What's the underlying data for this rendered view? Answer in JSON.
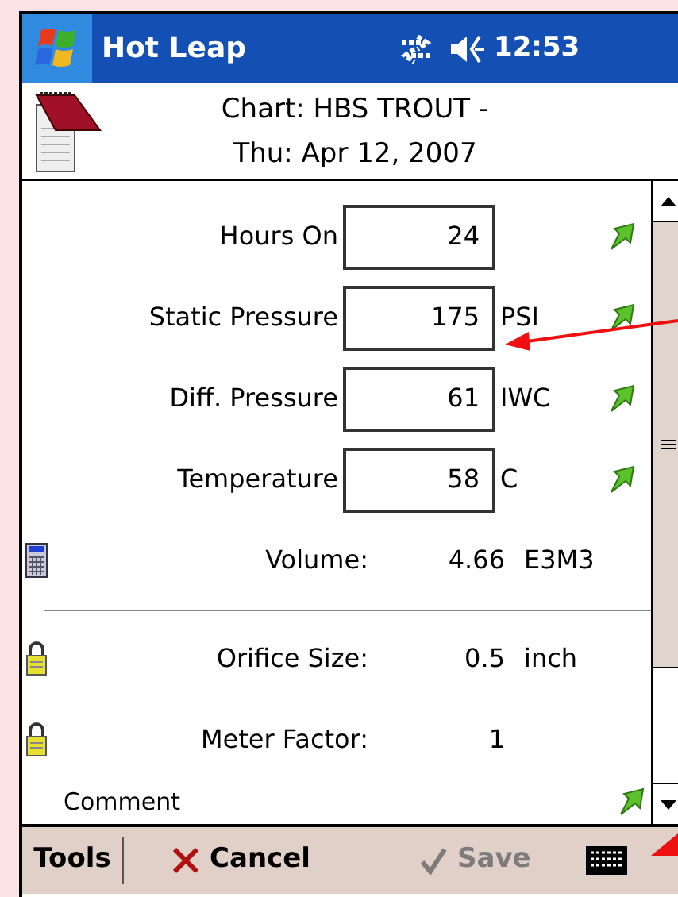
{
  "status_bar": {
    "app_title": "Hot Leap",
    "time": "12:53"
  },
  "header": {
    "line1": "Chart: HBS TROUT -",
    "line2": "Thu: Apr 12, 2007"
  },
  "fields": [
    {
      "kind": "input",
      "label": "Hours On",
      "value": "24"
    },
    {
      "kind": "input",
      "label": "Static Pressure",
      "value": "175",
      "unit": "PSI"
    },
    {
      "kind": "input",
      "label": "Diff. Pressure",
      "value": "61",
      "unit": "IWC"
    },
    {
      "kind": "input",
      "label": "Temperature",
      "value": "58",
      "unit": "C"
    },
    {
      "kind": "computed",
      "label": "Volume:",
      "value": "4.66",
      "unit": "E3M3"
    },
    {
      "kind": "locked",
      "label": "Orifice Size:",
      "value": "0.5",
      "unit": "inch"
    },
    {
      "kind": "locked",
      "label": "Meter Factor:",
      "value": "1"
    }
  ],
  "comment_label": "Comment",
  "menu_bar": [
    {
      "kind": "menu",
      "label": "Tools",
      "disabled": false
    },
    {
      "kind": "cancel",
      "label": "Cancel",
      "disabled": false
    },
    {
      "kind": "save",
      "label": "Save",
      "disabled": true
    }
  ]
}
